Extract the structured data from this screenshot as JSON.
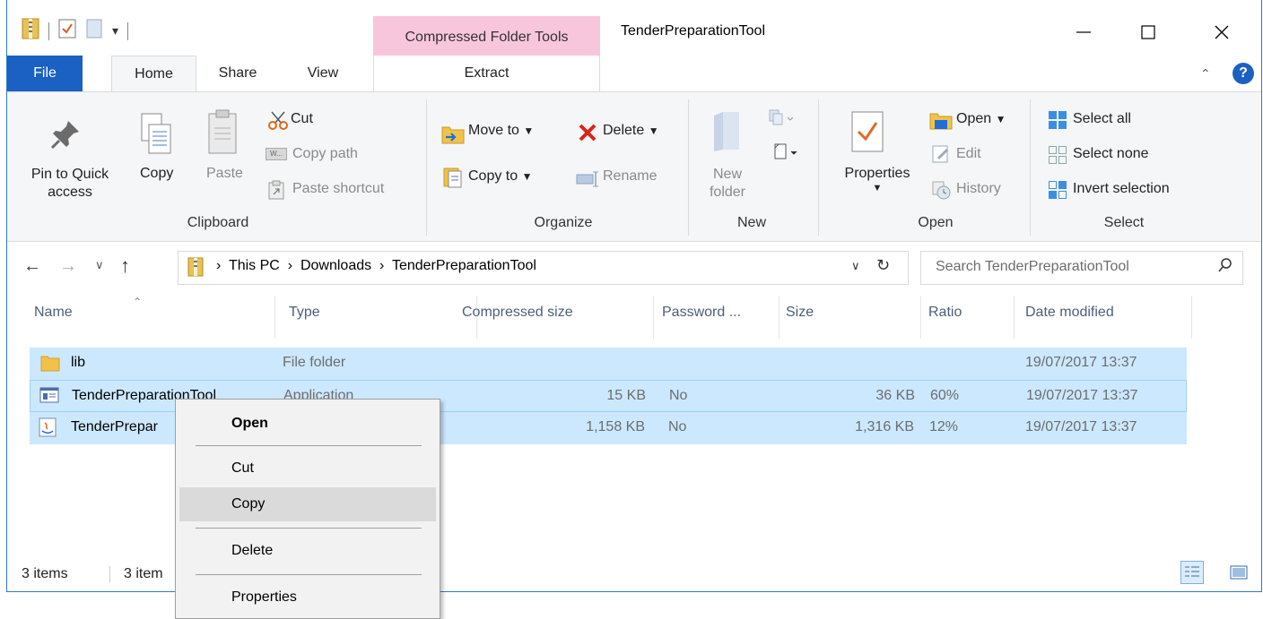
{
  "window": {
    "title": "TenderPreparationTool",
    "contextual_tab_group": "Compressed Folder Tools"
  },
  "tabs": {
    "file": "File",
    "home": "Home",
    "share": "Share",
    "view": "View",
    "extract": "Extract"
  },
  "ribbon": {
    "clipboard": {
      "group": "Clipboard",
      "pin_line1": "Pin to Quick",
      "pin_line2": "access",
      "copy": "Copy",
      "paste": "Paste",
      "cut": "Cut",
      "copy_path": "Copy path",
      "paste_shortcut": "Paste shortcut"
    },
    "organize": {
      "group": "Organize",
      "move_to": "Move to",
      "copy_to": "Copy to",
      "delete": "Delete",
      "rename": "Rename"
    },
    "new": {
      "group": "New",
      "new_folder_line1": "New",
      "new_folder_line2": "folder"
    },
    "open": {
      "group": "Open",
      "properties": "Properties",
      "open": "Open",
      "edit": "Edit",
      "history": "History"
    },
    "select": {
      "group": "Select",
      "select_all": "Select all",
      "select_none": "Select none",
      "invert_selection": "Invert selection"
    }
  },
  "address": {
    "crumbs": [
      "This PC",
      "Downloads",
      "TenderPreparationTool"
    ],
    "search_placeholder": "Search TenderPreparationTool"
  },
  "columns": {
    "name": "Name",
    "type": "Type",
    "compressed_size": "Compressed size",
    "password": "Password ...",
    "size": "Size",
    "ratio": "Ratio",
    "date_modified": "Date modified"
  },
  "files": [
    {
      "name": "lib",
      "type": "File folder",
      "compressed_size": "",
      "password": "",
      "size": "",
      "ratio": "",
      "date": "19/07/2017 13:37"
    },
    {
      "name": "TenderPreparationTool",
      "type": "Application",
      "compressed_size": "15 KB",
      "password": "No",
      "size": "36 KB",
      "ratio": "60%",
      "date": "19/07/2017 13:37"
    },
    {
      "name": "TenderPrepar",
      "type": "",
      "compressed_size": "1,158 KB",
      "password": "No",
      "size": "1,316 KB",
      "ratio": "12%",
      "date": "19/07/2017 13:37"
    }
  ],
  "status": {
    "items_count": "3 items",
    "selected_count": "3 item"
  },
  "context_menu": {
    "open": "Open",
    "cut": "Cut",
    "copy": "Copy",
    "delete": "Delete",
    "properties": "Properties"
  },
  "colors": {
    "accent": "#1b61c3",
    "selection": "#cce8ff",
    "contextual_tab": "#f8c6dc"
  }
}
